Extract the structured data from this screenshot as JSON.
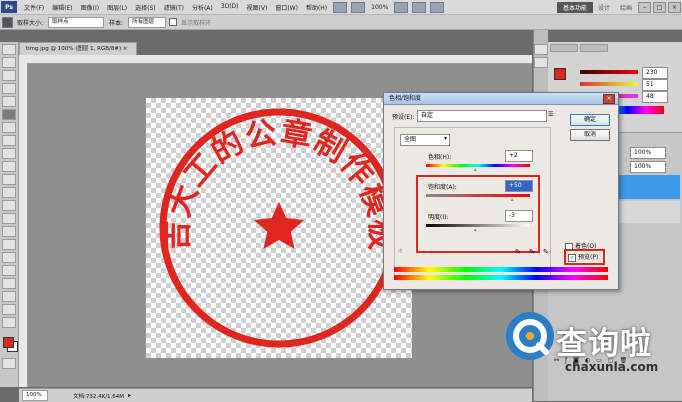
{
  "menubar": {
    "logo": "Ps",
    "items": [
      "文件(F)",
      "编辑(E)",
      "图像(I)",
      "图层(L)",
      "选择(S)",
      "滤镜(T)",
      "分析(A)",
      "3D(D)",
      "视图(V)",
      "窗口(W)",
      "帮助(H)"
    ],
    "zoom": "100%",
    "workspace": "基本功能",
    "workspace_links": [
      "设计",
      "绘画"
    ],
    "win_buttons": [
      "–",
      "□",
      "×"
    ]
  },
  "options_bar": {
    "sample_size_label": "取样大小:",
    "sample_size_value": "取样点",
    "sample_label": "样本:",
    "sample_value": "所有图层",
    "show_ring_label": "显示取样环"
  },
  "document": {
    "tab_title": "timg.jpg @ 100% (图层 1, RGB/8#) ×",
    "zoom": "100%",
    "doc_info": "文档:732.4K/1.64M"
  },
  "stamp": {
    "text": "吉大工的公章制作模板",
    "color": "#e0261f"
  },
  "color_panel": {
    "values": [
      "230",
      "51",
      "48"
    ]
  },
  "panels": {
    "zoom_a": "100%",
    "zoom_b": "100%"
  },
  "dialog": {
    "title": "色相/饱和度",
    "preset_label": "预设(E):",
    "preset_value": "自定",
    "channel_value": "全图",
    "hue_label": "色相(H):",
    "hue_value": "+2",
    "saturation_label": "饱和度(A):",
    "saturation_value": "+50",
    "lightness_label": "明度(I):",
    "lightness_value": "-3",
    "ok_label": "确定",
    "cancel_label": "取消",
    "colorize_label": "着色(O)",
    "preview_label": "预览(P)",
    "preview_checked": true
  },
  "watermark": {
    "text": "查询啦",
    "url": "chaxunla.com"
  },
  "colors": {
    "accent_red": "#e0261f",
    "watermark_blue": "#2b7ec6",
    "selection_blue": "#3d9be9"
  }
}
